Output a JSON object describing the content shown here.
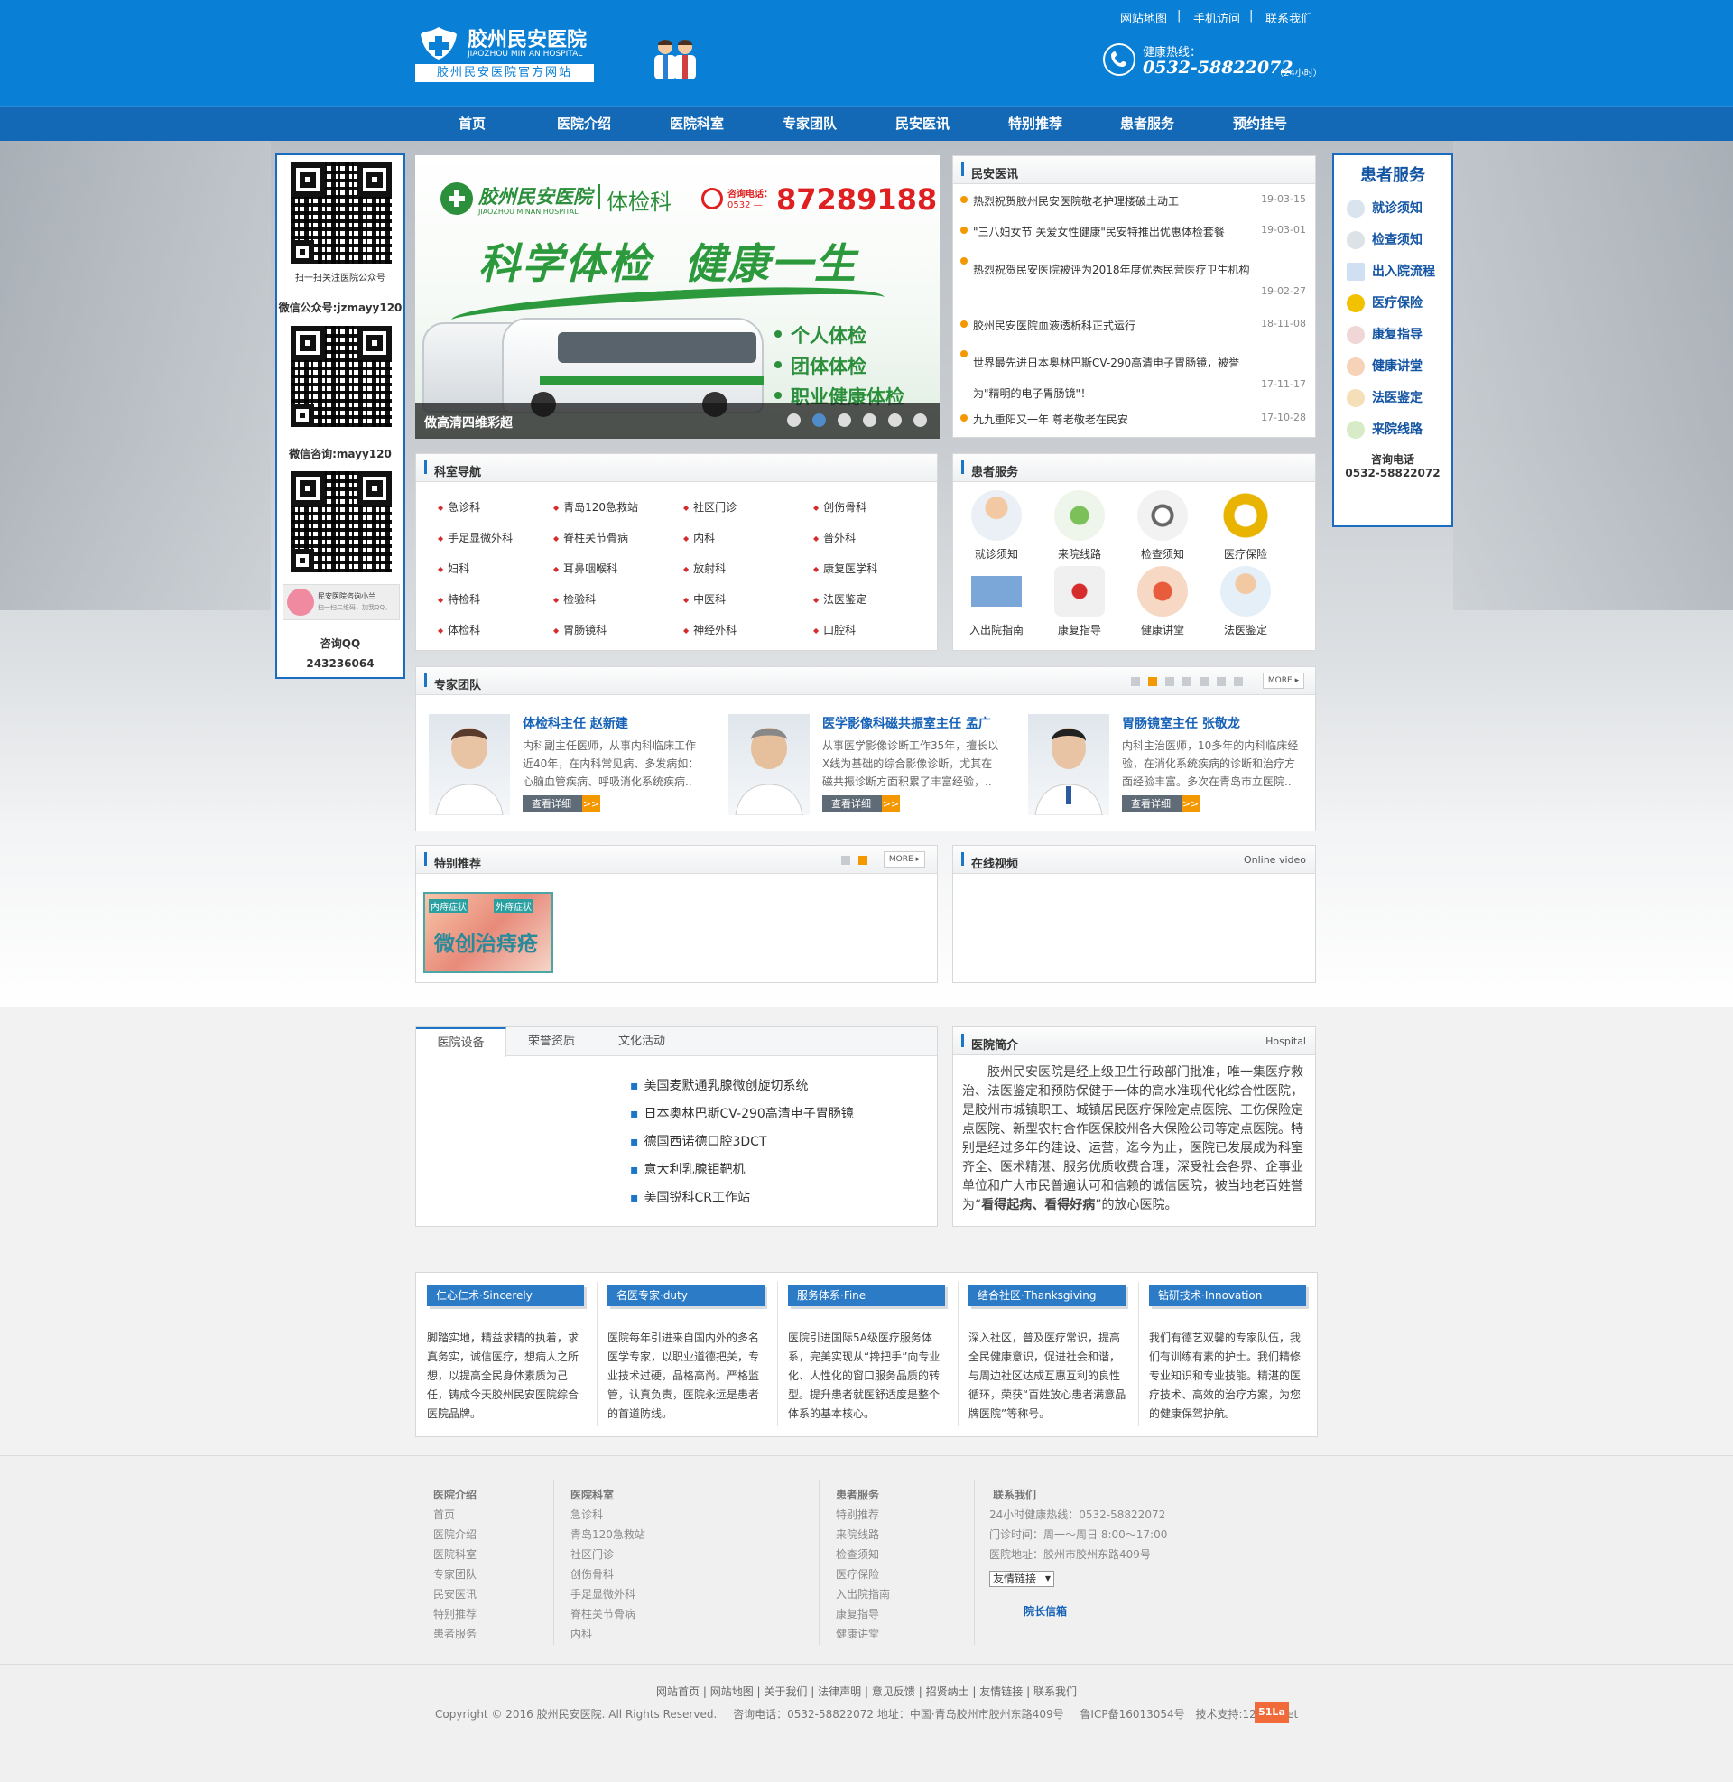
{
  "header": {
    "logo_title": "胶州民安医院",
    "logo_en": "JIAOZHOU MIN AN HOSPITAL",
    "logo_sub": "胶州民安医院官方网站",
    "top_links": [
      "网站地图",
      "手机访问",
      "联系我们"
    ],
    "hotline_label": "健康热线：",
    "hotline_number": "0532-58822072",
    "hotline_note": "（24小时）"
  },
  "nav": [
    "首页",
    "医院介绍",
    "医院科室",
    "专家团队",
    "民安医讯",
    "特别推荐",
    "患者服务",
    "预约挂号"
  ],
  "left_qr": {
    "caption1": "扫一扫关注医院公众号",
    "wechat_public": "微信公众号:jzmayy120",
    "wechat_consult": "微信咨询:mayy120",
    "chat_title": "民安医院咨询小兰",
    "chat_sub": "扫一扫二维码，加我QQ。",
    "qq_label": "咨询QQ",
    "qq_number": "243236064"
  },
  "banner": {
    "hospital": "胶州民安医院",
    "hospital_en": "JIAOZHOU MINAN HOSPITAL",
    "dept": "体检科",
    "tel_label": "咨询电话：",
    "tel_area": "0532 —",
    "tel": "87289188",
    "slogan": "科学体检  健康一生",
    "bullets": [
      "个人体检",
      "团体体检",
      "职业健康体检"
    ],
    "caption": "做高清四维彩超",
    "dots": 6
  },
  "news": {
    "title": "民安医讯",
    "items": [
      {
        "text": "热烈祝贺胶州民安医院敬老护理楼破土动工",
        "date": "19-03-15"
      },
      {
        "text": "\"三八妇女节 关爱女性健康\"民安特推出优惠体检套餐",
        "date": "19-03-01"
      },
      {
        "text": "热烈祝贺民安医院被评为2018年度优秀民营医疗卫生机构",
        "date": "19-02-27"
      },
      {
        "text": "胶州民安医院血液透析科正式运行",
        "date": "18-11-08"
      },
      {
        "text": "世界最先进日本奥林巴斯CV-290高清电子胃肠镜，被誉为\"精明的电子胃肠镜\"！",
        "date": "17-11-17"
      },
      {
        "text": "九九重阳又一年 尊老敬老在民安",
        "date": "17-10-28"
      }
    ]
  },
  "right_service": {
    "title": "患者服务",
    "items": [
      "就诊须知",
      "检查须知",
      "出入院流程",
      "医疗保险",
      "康复指导",
      "健康讲堂",
      "法医鉴定",
      "来院线路"
    ],
    "tel_label": "咨询电话",
    "tel": "0532-58822072"
  },
  "depts": {
    "title": "科室导航",
    "items": [
      "急诊科",
      "青岛120急救站",
      "社区门诊",
      "创伤骨科",
      "手足显微外科",
      "脊柱关节骨病",
      "内科",
      "普外科",
      "妇科",
      "耳鼻咽喉科",
      "放射科",
      "康复医学科",
      "特检科",
      "检验科",
      "中医科",
      "法医鉴定",
      "体检科",
      "胃肠镜科",
      "神经外科",
      "口腔科"
    ]
  },
  "services": {
    "title": "患者服务",
    "items": [
      "就诊须知",
      "来院线路",
      "检查须知",
      "医疗保险",
      "入出院指南",
      "康复指导",
      "健康讲堂",
      "法医鉴定"
    ]
  },
  "experts": {
    "title": "专家团队",
    "more": "MORE",
    "detail_label": "查看详细",
    "detail_arrow": ">>",
    "items": [
      {
        "name": "体检科主任 赵新建",
        "desc": "内科副主任医师，从事内科临床工作近40年，在内科常见病、多发病如：心脑血管疾病、呼吸消化系统疾病.."
      },
      {
        "name": "医学影像科磁共振室主任 孟广",
        "desc": "从事医学影像诊断工作35年，擅长以X线为基础的综合影像诊断，尤其在磁共振诊断方面积累了丰富经验，.."
      },
      {
        "name": "胃肠镜室主任 张敬龙",
        "desc": "内科主治医师，10多年的内科临床经验，在消化系统疾病的诊断和治疗方面经验丰富。多次在青岛市立医院.."
      }
    ]
  },
  "special": {
    "title": "特别推荐",
    "more": "MORE",
    "tag1": "内痔症状",
    "tag2": "外痔症状",
    "promo": "微创治痔疮"
  },
  "video": {
    "title": "在线视频",
    "sub": "Online video"
  },
  "tabs": {
    "items": [
      "医院设备",
      "荣誉资质",
      "文化活动"
    ],
    "equipment": [
      "美国麦默通乳腺微创旋切系统",
      "日本奥林巴斯CV-290高清电子胃肠镜",
      "德国西诺德口腔3DCT",
      "意大利乳腺钼靶机",
      "美国锐科CR工作站"
    ]
  },
  "intro": {
    "title": "医院简介",
    "sub": "Hospital",
    "text_before": "胶州民安医院是经上级卫生行政部门批准，唯一集医疗救治、法医鉴定和预防保健于一体的高水准现代化综合性医院，是胶州市城镇职工、城镇居民医疗保险定点医院、工伤保险定点医院、新型农村合作医保胶州各大保险公司等定点医院。特别是经过多年的建设、运营，迄今为止，医院已发展成为科室齐全、医术精湛、服务优质收费合理，深受社会各界、企事业单位和广大市民普遍认可和信赖的诚信医院，被当地老百姓誉为“",
    "text_bold": "看得起病、看得好病",
    "text_after": "”的放心医院。"
  },
  "pillars": [
    {
      "title": "仁心仁术·Sincerely",
      "text": "脚踏实地，精益求精的执着，求真务实，诚信医疗，想病人之所想，以提高全民身体素质为己任，铸成今天胶州民安医院综合医院品牌。"
    },
    {
      "title": "名医专家·duty",
      "text": "医院每年引进来自国内外的多名医学专家，以职业道德把关，专业技术过硬，品格高尚。严格监管，认真负责，医院永远是患者的首道防线。"
    },
    {
      "title": "服务体系·Fine",
      "text": "医院引进国际5A级医疗服务体系，完美实现从“搀把手”向专业化、人性化的窗口服务品质的转型。提升患者就医舒适度是整个体系的基本核心。"
    },
    {
      "title": "结合社区·Thanksgiving",
      "text": "深入社区，普及医疗常识，提高全民健康意识，促进社会和谐，与周边社区达成互惠互利的良性循环，荣获“百姓放心患者满意品牌医院”等称号。"
    },
    {
      "title": "钻研技术·Innovation",
      "text": "我们有德艺双馨的专家队伍，我们有训练有素的护士。我们精修专业知识和专业技能。精湛的医疗技术、高效的治疗方案，为您的健康保驾护航。"
    }
  ],
  "footer": {
    "col1_title": "医院介绍",
    "col1": [
      "首页",
      "医院介绍",
      "医院科室",
      "专家团队",
      "民安医讯",
      "特别推荐",
      "患者服务"
    ],
    "col2_title": "医院科室",
    "col2": [
      "急诊科",
      "青岛120急救站",
      "社区门诊",
      "创伤骨科",
      "手足显微外科",
      "脊柱关节骨病",
      "内科"
    ],
    "col3_title": "患者服务",
    "col3": [
      "特别推荐",
      "来院线路",
      "检查须知",
      "医疗保险",
      "入出院指南",
      "康复指导",
      "健康讲堂"
    ],
    "contact_title": "联系我们",
    "contact": [
      "24小时健康热线：0532-58822072",
      "门诊时间：周一～周日 8:00～17:00",
      "医院地址：胶州市胶州东路409号"
    ],
    "friend_select": "友情链接",
    "mailbox": "院长信箱",
    "links": [
      "网站首页",
      "网站地图",
      "关于我们",
      "法律声明",
      "意见反馈",
      "招贤纳士",
      "友情链接",
      "联系我们"
    ],
    "copyright": "Copyright © 2016 胶州民安医院. All Rights Reserved.",
    "contact_line": "咨询电话：0532-58822072 地址：中国·青岛胶州市胶州东路409号",
    "icp": "鲁ICP备16013054号",
    "support": "技术支持:12536.net",
    "badge": "51La"
  }
}
